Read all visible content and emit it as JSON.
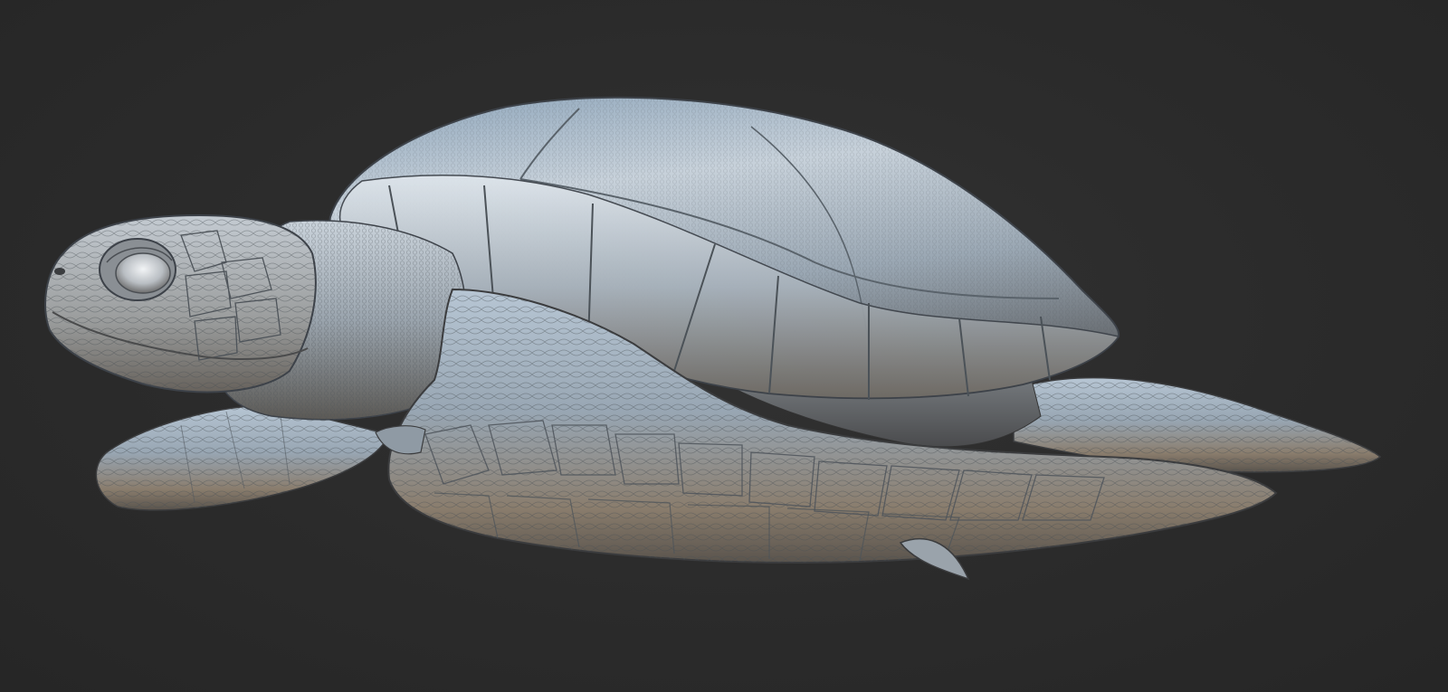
{
  "scene": {
    "subject_icon": "sea-turtle-icon",
    "colors": {
      "background": "#2b2b2b",
      "material_highlight": "#e9edf2",
      "material_light": "#b9c4cf",
      "material_mid": "#7f8c99",
      "material_shadow": "#3d4249",
      "warm_tint": "#a08a70"
    }
  }
}
